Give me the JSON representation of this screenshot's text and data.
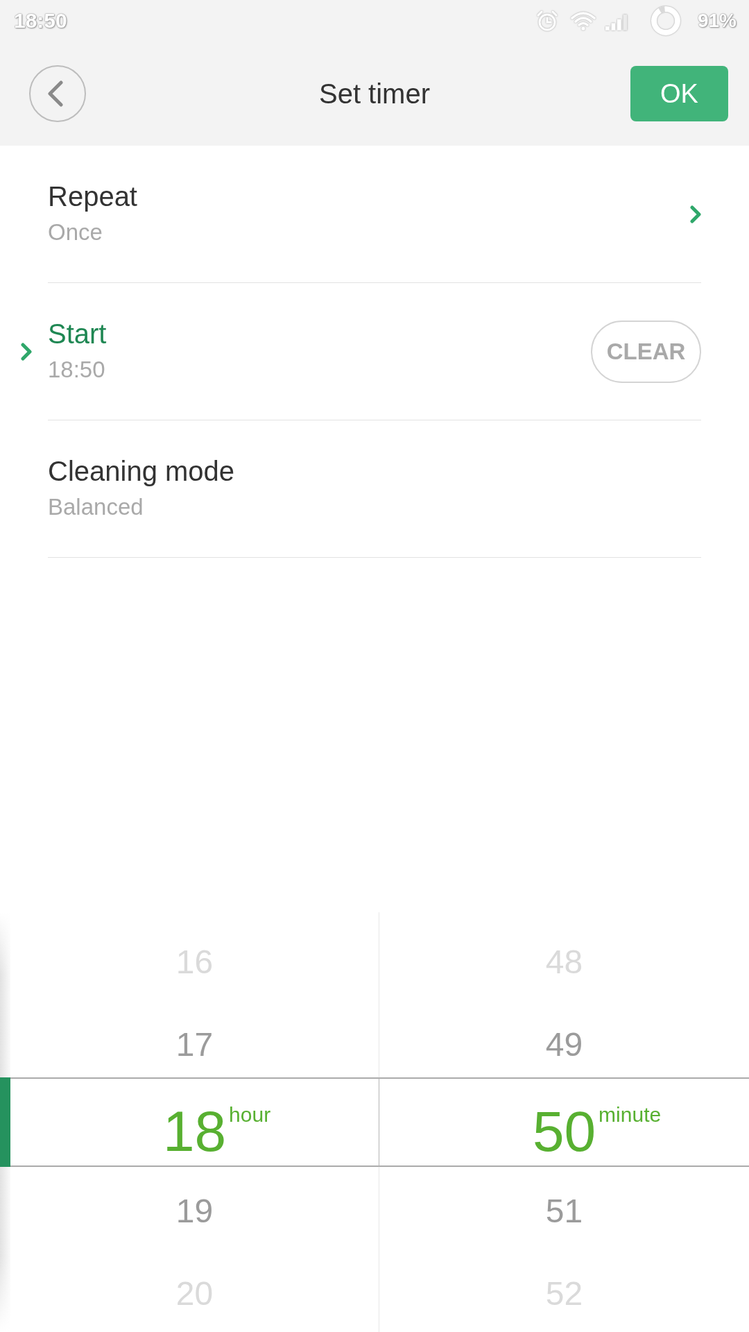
{
  "status_bar": {
    "time": "18:50",
    "battery": "91%"
  },
  "header": {
    "title": "Set timer",
    "confirm_button": "OK"
  },
  "settings": [
    {
      "kind": "link",
      "label": "Repeat",
      "value": "Once",
      "selected": false
    },
    {
      "kind": "clearable",
      "label": "Start",
      "value": "18:50",
      "selected": true,
      "action": "CLEAR"
    },
    {
      "kind": "plain",
      "label": "Cleaning mode",
      "value": "Balanced",
      "selected": false
    }
  ],
  "time_picker": {
    "columns": [
      {
        "unit": "hour",
        "items": [
          {
            "label": "16",
            "selected": false
          },
          {
            "label": "17",
            "selected": false
          },
          {
            "label": "18",
            "selected": true
          },
          {
            "label": "19",
            "selected": false
          },
          {
            "label": "20",
            "selected": false
          }
        ]
      },
      {
        "unit": "minute",
        "items": [
          {
            "label": "48",
            "selected": false
          },
          {
            "label": "49",
            "selected": false
          },
          {
            "label": "50",
            "selected": true
          },
          {
            "label": "51",
            "selected": false
          },
          {
            "label": "52",
            "selected": false
          }
        ]
      }
    ]
  }
}
